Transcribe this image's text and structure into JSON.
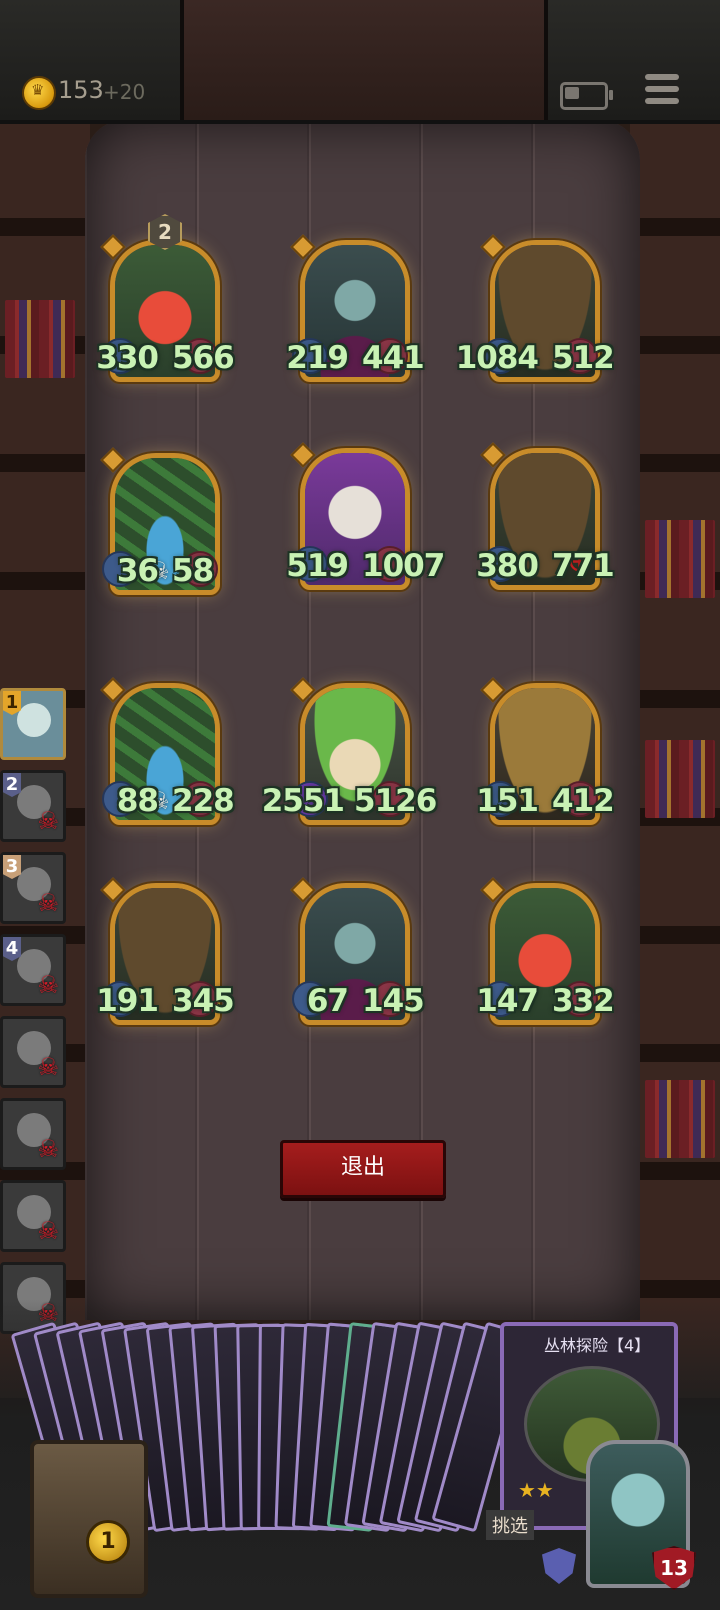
{
  "topbar": {
    "gold": "153",
    "gold_bonus": "+20"
  },
  "board_units": [
    {
      "id": "tomato",
      "attack": "330",
      "health": "566",
      "tier": "2",
      "portrait": "tomato-monster"
    },
    {
      "id": "elf",
      "attack": "219",
      "health": "441",
      "portrait": "blue-haired-elf"
    },
    {
      "id": "goblin",
      "attack": "1084",
      "health": "512",
      "portrait": "goblin-hat"
    },
    {
      "id": "vine",
      "attack": "36",
      "health": "58",
      "portrait": "vine-plant",
      "deathrattle": "skull-icon"
    },
    {
      "id": "bird",
      "attack": "519",
      "health": "1007",
      "portrait": "white-bird"
    },
    {
      "id": "goblin2",
      "attack": "380",
      "health": "771",
      "portrait": "goblin-hat",
      "marker": "target-icon"
    },
    {
      "id": "vine2",
      "attack": "88",
      "health": "228",
      "portrait": "vine-plant",
      "deathrattle": "skull-icon"
    },
    {
      "id": "leaf",
      "attack": "2551",
      "health": "5126",
      "portrait": "leaf-child"
    },
    {
      "id": "wizard",
      "attack": "151",
      "health": "412",
      "portrait": "old-wizard"
    },
    {
      "id": "goblin3",
      "attack": "191",
      "health": "345",
      "portrait": "goblin-hat"
    },
    {
      "id": "elf2",
      "attack": "67",
      "health": "145",
      "portrait": "blue-haired-elf"
    },
    {
      "id": "tomato2",
      "attack": "147",
      "health": "332",
      "portrait": "tomato-monster"
    }
  ],
  "opponents": [
    {
      "rank": "1",
      "eliminated": false
    },
    {
      "rank": "2",
      "eliminated": true
    },
    {
      "rank": "3",
      "eliminated": true
    },
    {
      "rank": "4",
      "eliminated": true
    },
    {
      "rank": "",
      "eliminated": true
    },
    {
      "rank": "",
      "eliminated": true
    },
    {
      "rank": "",
      "eliminated": true
    },
    {
      "rank": "",
      "eliminated": true
    }
  ],
  "exit_button": "退出",
  "deck": {
    "featured_title": "丛林探险【4】",
    "challenge_label": "挑选",
    "chest_count": "1",
    "hero_health": "13"
  },
  "colors": {
    "stat_text": "#c9f2b4",
    "exit_button": "#a51d1d",
    "frame_gold": "#c88c2a"
  }
}
